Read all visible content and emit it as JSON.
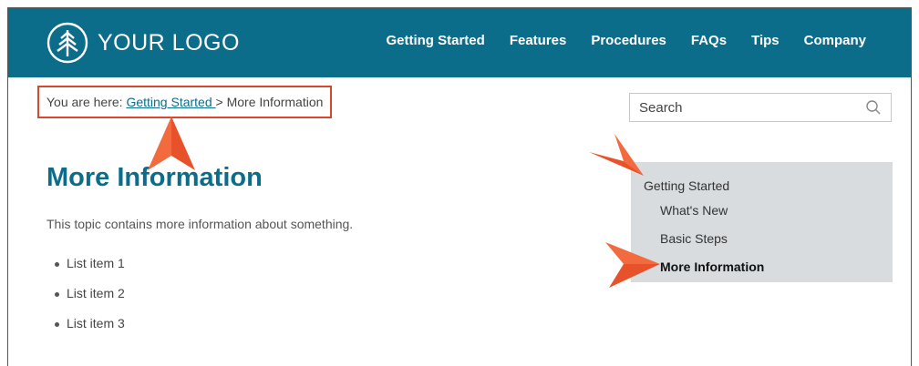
{
  "header": {
    "logo_text": "YOUR LOGO",
    "nav": [
      "Getting Started",
      "Features",
      "Procedures",
      "FAQs",
      "Tips",
      "Company"
    ],
    "bg_color": "#0c6d8b"
  },
  "breadcrumb": {
    "prefix": "You are here: ",
    "link": "Getting Started ",
    "separator": "> ",
    "current": "More Information"
  },
  "search": {
    "placeholder": "Search"
  },
  "main": {
    "title": "More Information",
    "intro": "This topic contains more information about something.",
    "list": [
      "List item 1",
      "List item 2",
      "List item 3"
    ]
  },
  "toc": {
    "items": [
      {
        "label": "Getting Started",
        "level": 0,
        "active": false
      },
      {
        "label": "What's New",
        "level": 1,
        "active": false
      },
      {
        "label": "Basic Steps",
        "level": 1,
        "active": false
      },
      {
        "label": "More Information",
        "level": 1,
        "active": true
      }
    ]
  },
  "annotation_color": "#e8522a"
}
